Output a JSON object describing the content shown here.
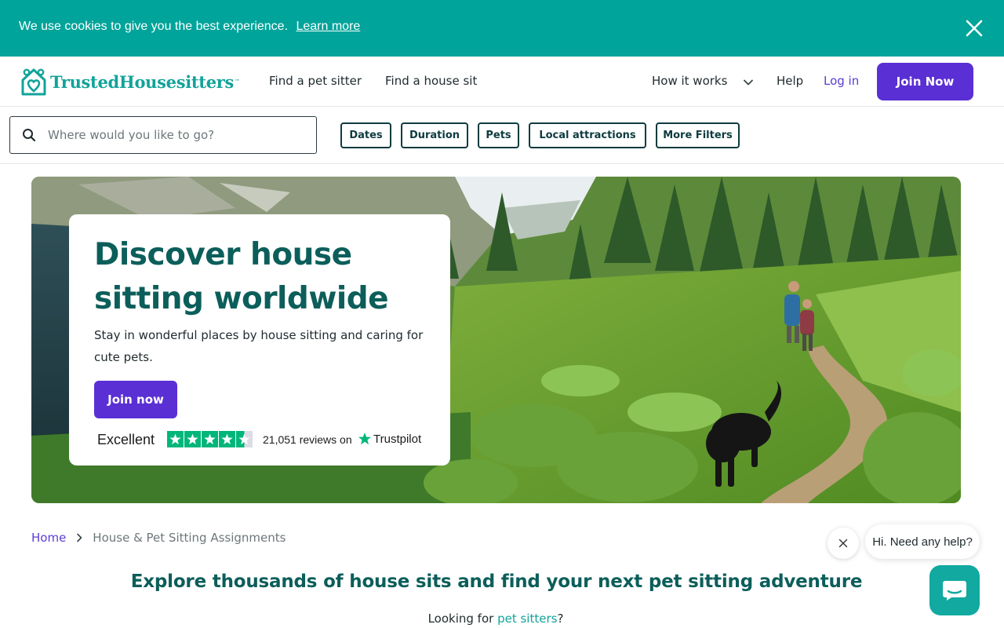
{
  "cookie_banner": {
    "text": "We use cookies to give you the best experience.",
    "link": "Learn more",
    "close_icon": "close-icon"
  },
  "header": {
    "logo_text": "TrustedHousesitters",
    "logo_tm": "™",
    "nav": {
      "find_pet_sitter": "Find a pet sitter",
      "find_house_sit": "Find a house sit",
      "how_it_works": "How it works",
      "help": "Help",
      "log_in": "Log in"
    },
    "join_label": "Join Now"
  },
  "search": {
    "placeholder": "Where would you like to go?",
    "value": "",
    "icon": "search-icon"
  },
  "filters": [
    "Dates",
    "Duration",
    "Pets",
    "Local attractions",
    "More Filters"
  ],
  "hero": {
    "title": "Discover house sitting worldwide",
    "subtitle": "Stay in wonderful places by house sitting and caring for cute pets.",
    "cta": "Join now",
    "trustpilot": {
      "rating_word": "Excellent",
      "stars": 4.5,
      "reviews": "21,051 reviews on",
      "brand": "Trustpilot"
    }
  },
  "breadcrumb": {
    "home": "Home",
    "current": "House & Pet Sitting Assignments"
  },
  "main": {
    "heading": "Explore thousands of house sits and find your next pet sitting adventure",
    "looking_prefix": "Looking for ",
    "looking_link": "pet sitters",
    "looking_suffix": "?"
  },
  "chat": {
    "bubble": "Hi. Need any help?"
  },
  "colors": {
    "teal": "#00a49a",
    "purple": "#5a2fd4",
    "dark_teal": "#0c5e5a",
    "trustpilot_green": "#00b67a"
  }
}
